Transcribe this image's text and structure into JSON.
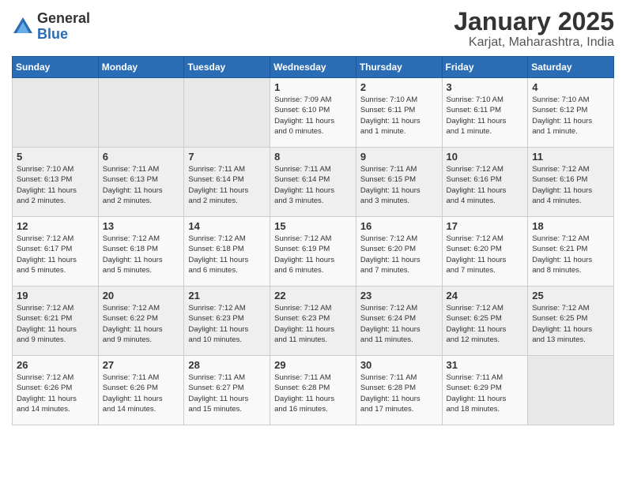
{
  "header": {
    "logo_general": "General",
    "logo_blue": "Blue",
    "title": "January 2025",
    "subtitle": "Karjat, Maharashtra, India"
  },
  "days_of_week": [
    "Sunday",
    "Monday",
    "Tuesday",
    "Wednesday",
    "Thursday",
    "Friday",
    "Saturday"
  ],
  "weeks": [
    [
      {
        "day": "",
        "info": ""
      },
      {
        "day": "",
        "info": ""
      },
      {
        "day": "",
        "info": ""
      },
      {
        "day": "1",
        "info": "Sunrise: 7:09 AM\nSunset: 6:10 PM\nDaylight: 11 hours\nand 0 minutes."
      },
      {
        "day": "2",
        "info": "Sunrise: 7:10 AM\nSunset: 6:11 PM\nDaylight: 11 hours\nand 1 minute."
      },
      {
        "day": "3",
        "info": "Sunrise: 7:10 AM\nSunset: 6:11 PM\nDaylight: 11 hours\nand 1 minute."
      },
      {
        "day": "4",
        "info": "Sunrise: 7:10 AM\nSunset: 6:12 PM\nDaylight: 11 hours\nand 1 minute."
      }
    ],
    [
      {
        "day": "5",
        "info": "Sunrise: 7:10 AM\nSunset: 6:13 PM\nDaylight: 11 hours\nand 2 minutes."
      },
      {
        "day": "6",
        "info": "Sunrise: 7:11 AM\nSunset: 6:13 PM\nDaylight: 11 hours\nand 2 minutes."
      },
      {
        "day": "7",
        "info": "Sunrise: 7:11 AM\nSunset: 6:14 PM\nDaylight: 11 hours\nand 2 minutes."
      },
      {
        "day": "8",
        "info": "Sunrise: 7:11 AM\nSunset: 6:14 PM\nDaylight: 11 hours\nand 3 minutes."
      },
      {
        "day": "9",
        "info": "Sunrise: 7:11 AM\nSunset: 6:15 PM\nDaylight: 11 hours\nand 3 minutes."
      },
      {
        "day": "10",
        "info": "Sunrise: 7:12 AM\nSunset: 6:16 PM\nDaylight: 11 hours\nand 4 minutes."
      },
      {
        "day": "11",
        "info": "Sunrise: 7:12 AM\nSunset: 6:16 PM\nDaylight: 11 hours\nand 4 minutes."
      }
    ],
    [
      {
        "day": "12",
        "info": "Sunrise: 7:12 AM\nSunset: 6:17 PM\nDaylight: 11 hours\nand 5 minutes."
      },
      {
        "day": "13",
        "info": "Sunrise: 7:12 AM\nSunset: 6:18 PM\nDaylight: 11 hours\nand 5 minutes."
      },
      {
        "day": "14",
        "info": "Sunrise: 7:12 AM\nSunset: 6:18 PM\nDaylight: 11 hours\nand 6 minutes."
      },
      {
        "day": "15",
        "info": "Sunrise: 7:12 AM\nSunset: 6:19 PM\nDaylight: 11 hours\nand 6 minutes."
      },
      {
        "day": "16",
        "info": "Sunrise: 7:12 AM\nSunset: 6:20 PM\nDaylight: 11 hours\nand 7 minutes."
      },
      {
        "day": "17",
        "info": "Sunrise: 7:12 AM\nSunset: 6:20 PM\nDaylight: 11 hours\nand 7 minutes."
      },
      {
        "day": "18",
        "info": "Sunrise: 7:12 AM\nSunset: 6:21 PM\nDaylight: 11 hours\nand 8 minutes."
      }
    ],
    [
      {
        "day": "19",
        "info": "Sunrise: 7:12 AM\nSunset: 6:21 PM\nDaylight: 11 hours\nand 9 minutes."
      },
      {
        "day": "20",
        "info": "Sunrise: 7:12 AM\nSunset: 6:22 PM\nDaylight: 11 hours\nand 9 minutes."
      },
      {
        "day": "21",
        "info": "Sunrise: 7:12 AM\nSunset: 6:23 PM\nDaylight: 11 hours\nand 10 minutes."
      },
      {
        "day": "22",
        "info": "Sunrise: 7:12 AM\nSunset: 6:23 PM\nDaylight: 11 hours\nand 11 minutes."
      },
      {
        "day": "23",
        "info": "Sunrise: 7:12 AM\nSunset: 6:24 PM\nDaylight: 11 hours\nand 11 minutes."
      },
      {
        "day": "24",
        "info": "Sunrise: 7:12 AM\nSunset: 6:25 PM\nDaylight: 11 hours\nand 12 minutes."
      },
      {
        "day": "25",
        "info": "Sunrise: 7:12 AM\nSunset: 6:25 PM\nDaylight: 11 hours\nand 13 minutes."
      }
    ],
    [
      {
        "day": "26",
        "info": "Sunrise: 7:12 AM\nSunset: 6:26 PM\nDaylight: 11 hours\nand 14 minutes."
      },
      {
        "day": "27",
        "info": "Sunrise: 7:11 AM\nSunset: 6:26 PM\nDaylight: 11 hours\nand 14 minutes."
      },
      {
        "day": "28",
        "info": "Sunrise: 7:11 AM\nSunset: 6:27 PM\nDaylight: 11 hours\nand 15 minutes."
      },
      {
        "day": "29",
        "info": "Sunrise: 7:11 AM\nSunset: 6:28 PM\nDaylight: 11 hours\nand 16 minutes."
      },
      {
        "day": "30",
        "info": "Sunrise: 7:11 AM\nSunset: 6:28 PM\nDaylight: 11 hours\nand 17 minutes."
      },
      {
        "day": "31",
        "info": "Sunrise: 7:11 AM\nSunset: 6:29 PM\nDaylight: 11 hours\nand 18 minutes."
      },
      {
        "day": "",
        "info": ""
      }
    ]
  ]
}
